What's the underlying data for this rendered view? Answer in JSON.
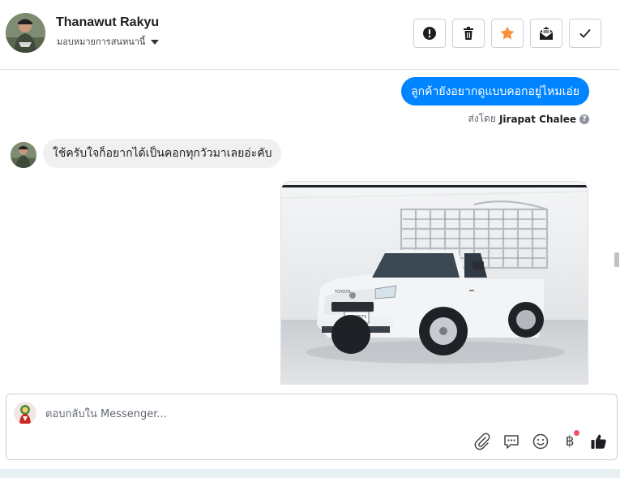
{
  "header": {
    "contact_name": "Thanawut Rakyu",
    "assign_label": "มอบหมายการสนทนานี้",
    "actions": [
      {
        "name": "report-spam-button",
        "icon": "exclamation-icon"
      },
      {
        "name": "delete-button",
        "icon": "trash-icon"
      },
      {
        "name": "star-button",
        "icon": "star-icon"
      },
      {
        "name": "mark-unread-button",
        "icon": "envelope-icon"
      },
      {
        "name": "mark-done-button",
        "icon": "check-icon"
      }
    ],
    "star_color": "#f7923a"
  },
  "messages": {
    "outgoing_text": "ลูกค้ายังอยากดูแบบคอกอยู่ไหมเอ่ย",
    "sent_by_prefix": "ส่งโดย",
    "sent_by_name": "Jirapat Chalee",
    "help_glyph": "?",
    "incoming_text": "ใช้ครับใจก็อยากได้เป็นคอกทุกวัวมาเลยอ่ะคับ",
    "photo_plate": "9ขข 9573",
    "photo_brand": "TOYOTA"
  },
  "composer": {
    "placeholder": "ตอบกลับใน Messenger...",
    "value": "",
    "tools": [
      "paperclip-icon",
      "saved-reply-icon",
      "emoji-icon",
      "payment-icon",
      "like-icon"
    ],
    "baht_glyph": "฿"
  },
  "colors": {
    "outgoing_bubble": "#0084ff",
    "incoming_bubble": "#f0f0f0",
    "notification_dot": "#f25268"
  }
}
